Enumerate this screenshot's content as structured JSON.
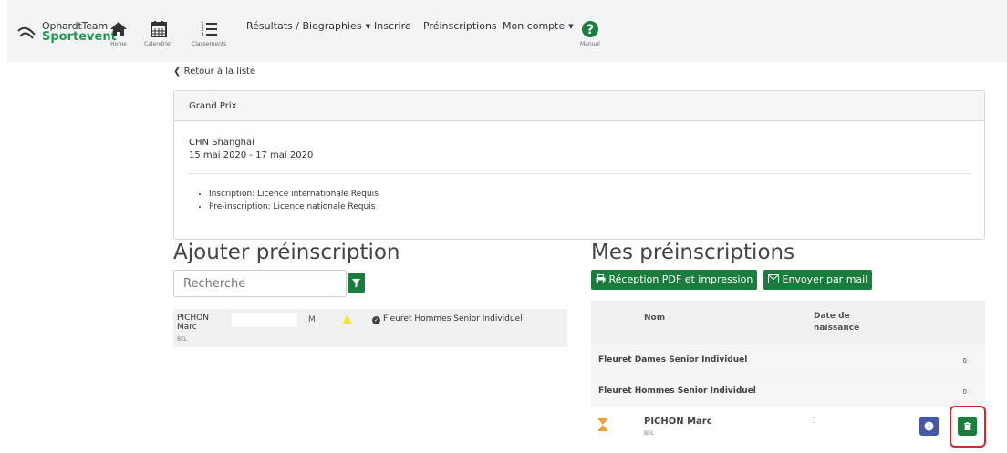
{
  "brand": {
    "line1": "OphardtTeam",
    "line2": "Sportevent"
  },
  "nav": {
    "home": "Home",
    "calendar": "Calendrier",
    "rankings": "Classements",
    "results": "Résultats / Biographies",
    "register": "Inscrire",
    "preregistrations": "Préinscriptions",
    "account": "Mon compte",
    "manual": "Manuel"
  },
  "back_link": "Retour à la liste",
  "competition": {
    "type": "Grand Prix",
    "place": "CHN Shanghai",
    "dates": "15 mai 2020 - 17 mai 2020",
    "requirements": [
      "Inscription: Licence internationale Requis",
      "Pre-inscription: Licence nationale Requis"
    ]
  },
  "add": {
    "title": "Ajouter préinscription",
    "search_placeholder": "Recherche",
    "result": {
      "last": "PICHON",
      "first": "Marc",
      "country": "BEL",
      "sex": "M",
      "event": "Fleuret Hommes Senior Individuel"
    }
  },
  "mine": {
    "title": "Mes préinscriptions",
    "pdf_button": "Réception PDF et impression",
    "mail_button": "Envoyer par mail",
    "col_name": "Nom",
    "col_dob_line1": "Date de",
    "col_dob_line2": "naissance",
    "groups": [
      {
        "title": "Fleuret Dames Senior Individuel",
        "count": "0"
      },
      {
        "title": "Fleuret Hommes Senior Individuel",
        "count": "0"
      }
    ],
    "entry": {
      "name": "PICHON Marc",
      "country": "BEL"
    }
  },
  "colors": {
    "accent": "#1a7d3e",
    "info": "#4557a7",
    "highlight": "#cc2a2a",
    "warning": "#f5d800",
    "pending": "#f0a030"
  }
}
